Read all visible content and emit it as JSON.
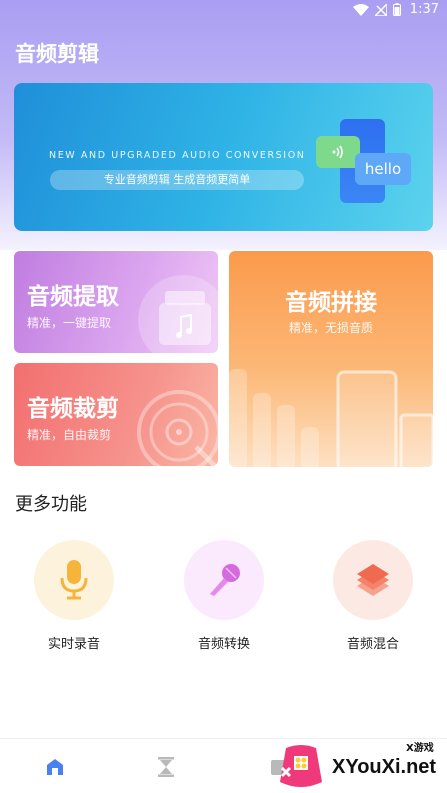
{
  "status_bar": {
    "time": "1:37"
  },
  "app": {
    "title": "音频剪辑"
  },
  "banner": {
    "english_text": "NEW AND UPGRADED AUDIO CONVERSION",
    "slogan": "专业音频剪辑    生成音频更简单",
    "bubble_text": "hello"
  },
  "cards": {
    "extract": {
      "title": "音频提取",
      "subtitle": "精准，一键提取"
    },
    "cut": {
      "title": "音频裁剪",
      "subtitle": "精准，自由裁剪"
    },
    "join": {
      "title": "音频拼接",
      "subtitle": "精准，无损音质"
    }
  },
  "more": {
    "title": "更多功能",
    "items": [
      {
        "label": "实时录音",
        "icon": "microphone-icon",
        "bg": "#fdf3dc"
      },
      {
        "label": "音频转换",
        "icon": "karaoke-mic-icon",
        "bg": "#fbeafd"
      },
      {
        "label": "音频混合",
        "icon": "layers-icon",
        "bg": "#fde9e3"
      }
    ]
  },
  "nav": {
    "items": [
      {
        "icon": "home-icon"
      },
      {
        "icon": "hourglass-icon"
      },
      {
        "icon": "folder-icon"
      }
    ]
  },
  "watermark": {
    "text": "XYouXi.net",
    "small": "X游戏"
  },
  "colors": {
    "header_gradient_top": "#a99ef2",
    "extract_card": "#c07de0",
    "cut_card": "#f26f6f",
    "join_card": "#fb9a4c",
    "nav_active": "#4a80f0"
  }
}
